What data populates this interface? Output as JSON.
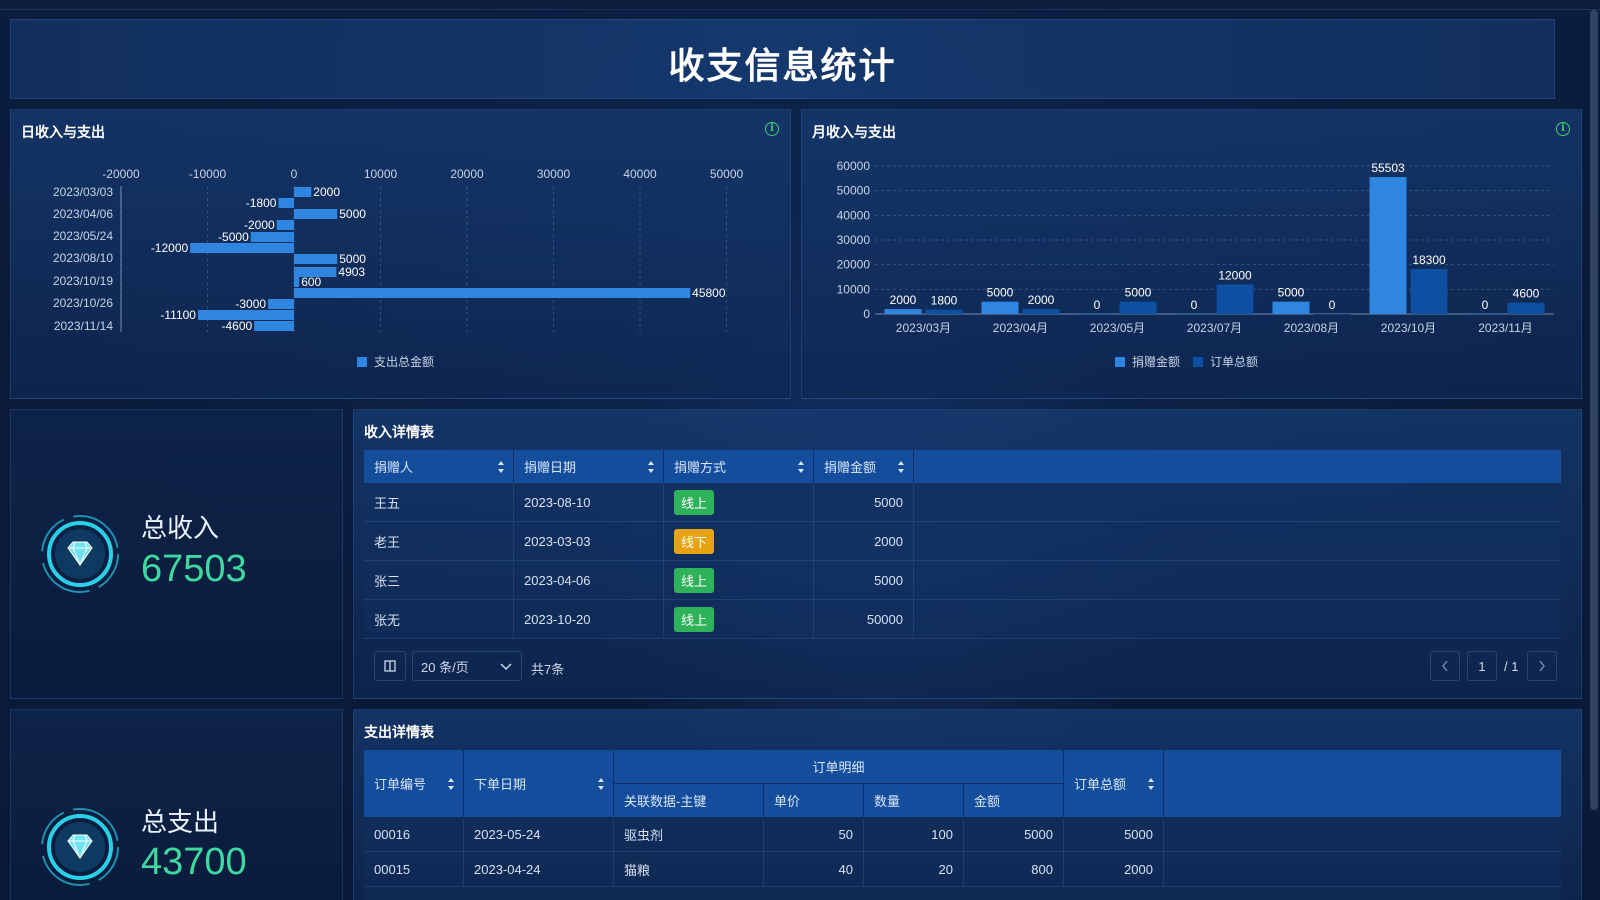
{
  "page": {
    "title": "收支信息统计"
  },
  "daily_chart": {
    "title": "日收入与支出",
    "legend": [
      "支出总金额"
    ],
    "colors": {
      "bar": "#2f86e0"
    },
    "chart_data": {
      "type": "bar",
      "orientation": "horizontal",
      "xlim": [
        -20000,
        50000
      ],
      "xticks": [
        -20000,
        -10000,
        0,
        10000,
        20000,
        30000,
        40000,
        50000
      ],
      "ytick_labels": [
        "2023/03/03",
        "2023/04/06",
        "2023/05/24",
        "2023/08/10",
        "2023/10/19",
        "2023/10/26",
        "2023/11/14"
      ],
      "values": [
        2000,
        -1800,
        5000,
        -2000,
        -5000,
        -12000,
        5000,
        4903,
        600,
        45800,
        -3000,
        -11100,
        -4600
      ],
      "labels": [
        "2000",
        "-1800",
        "5000",
        "-2000",
        "-5000",
        "-12000",
        "5000",
        "4903",
        "600",
        "45800",
        "-3000",
        "-11100",
        "-4600"
      ],
      "series": [
        {
          "name": "支出总金额"
        }
      ]
    }
  },
  "monthly_chart": {
    "title": "月收入与支出",
    "legend": [
      "捐赠金额",
      "订单总额"
    ],
    "colors": {
      "donation": "#2f86e0",
      "order": "#0d4fa0"
    },
    "chart_data": {
      "type": "bar",
      "categories": [
        "2023/03月",
        "2023/04月",
        "2023/05月",
        "2023/07月",
        "2023/08月",
        "2023/10月",
        "2023/11月"
      ],
      "ylim": [
        0,
        60000
      ],
      "yticks": [
        0,
        10000,
        20000,
        30000,
        40000,
        50000,
        60000
      ],
      "series": [
        {
          "name": "捐赠金额",
          "values": [
            2000,
            5000,
            0,
            0,
            5000,
            55503,
            0
          ]
        },
        {
          "name": "订单总额",
          "values": [
            1800,
            2000,
            5000,
            12000,
            0,
            18300,
            4600
          ]
        }
      ]
    }
  },
  "income_stat": {
    "label": "总收入",
    "value": "67503",
    "icon": "diamond-icon"
  },
  "expense_stat": {
    "label": "总支出",
    "value": "43700",
    "icon": "diamond-icon"
  },
  "income_table": {
    "title": "收入详情表",
    "columns": [
      "捐赠人",
      "捐赠日期",
      "捐赠方式",
      "捐赠金额"
    ],
    "rows": [
      {
        "donor": "王五",
        "date": "2023-08-10",
        "method": "线上",
        "amount": "5000"
      },
      {
        "donor": "老王",
        "date": "2023-03-03",
        "method": "线下",
        "amount": "2000"
      },
      {
        "donor": "张三",
        "date": "2023-04-06",
        "method": "线上",
        "amount": "5000"
      },
      {
        "donor": "张无",
        "date": "2023-10-20",
        "method": "线上",
        "amount": "50000"
      }
    ],
    "pager": {
      "page_size": "20 条/页",
      "total": "共7条",
      "current_page": "1",
      "total_pages": "/ 1"
    }
  },
  "expense_table": {
    "title": "支出详情表",
    "columns": [
      "订单编号",
      "下单日期",
      "订单明细",
      "订单总额"
    ],
    "sub_columns": [
      "关联数据-主键",
      "单价",
      "数量",
      "金额"
    ],
    "rows": [
      {
        "order_no": "00016",
        "date": "2023-05-24",
        "item": "驱虫剂",
        "price": "50",
        "qty": "100",
        "amount": "5000",
        "total": "5000"
      },
      {
        "order_no": "00015",
        "date": "2023-04-24",
        "item": "猫粮",
        "price": "40",
        "qty": "20",
        "amount": "800",
        "total": "2000"
      }
    ]
  }
}
